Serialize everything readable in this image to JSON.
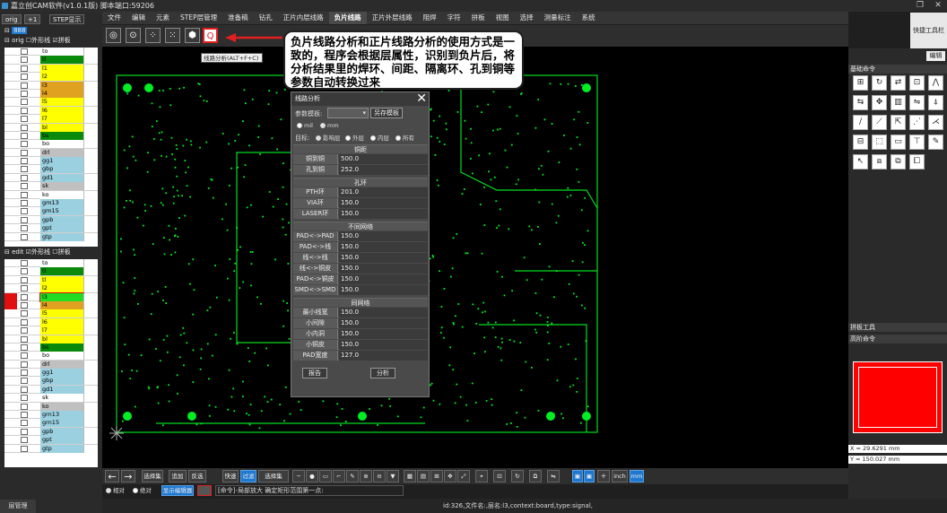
{
  "app": {
    "title": "嘉立创CAM软件(v1.0.1版) 脚本端口:59206"
  },
  "menu": [
    "文件",
    "编辑",
    "元素",
    "STEP层管理",
    "准备稿",
    "钻孔",
    "正片内层线路",
    "负片线路",
    "正片外层线路",
    "阻焊",
    "字符",
    "拼板",
    "视图",
    "选择",
    "测量标注",
    "系统"
  ],
  "menu_active_index": 7,
  "quick_toolbar_label": "快捷工具栏",
  "toolbar": {
    "buttons": [
      "◎",
      "⊙",
      "⁘",
      "⁙",
      "⬢",
      "Q"
    ],
    "tooltip": "线路分析(ALT+F+C)"
  },
  "callout": {
    "text": "负片线路分析和正片线路分析的使用方式是一致的，程序会根据层属性，识别到负片后，将分析结果里的焊环、间距、隔离环、孔到铜等参数自动转换过来"
  },
  "left_panel": {
    "tabs": [
      "orig",
      "+1",
      "STEP显示"
    ],
    "root": "888",
    "orig_group": {
      "label": "orig",
      "outline_label": "外形线",
      "panel_label": "拼板"
    },
    "edit_group": {
      "label": "edit",
      "outline_label": "外形线",
      "panel_label": "拼板"
    },
    "orig_layers": [
      {
        "name": "to",
        "color": "#ffffff"
      },
      {
        "name": "tl",
        "color": "#0a8a0a"
      },
      {
        "name": "l1",
        "color": "#ffff00"
      },
      {
        "name": "l2",
        "color": "#ffff00"
      },
      {
        "name": "l3",
        "color": "#e0a020"
      },
      {
        "name": "l4",
        "color": "#e0a020"
      },
      {
        "name": "l5",
        "color": "#ffff00"
      },
      {
        "name": "l6",
        "color": "#ffff00"
      },
      {
        "name": "l7",
        "color": "#ffff00"
      },
      {
        "name": "bl",
        "color": "#ffff00"
      },
      {
        "name": "bs",
        "color": "#0a8a0a"
      },
      {
        "name": "bo",
        "color": "#ffffff"
      },
      {
        "name": "drl",
        "color": "#c0c0c0"
      },
      {
        "name": "gg1",
        "color": "#9ad0e0"
      },
      {
        "name": "gbp",
        "color": "#9ad0e0"
      },
      {
        "name": "gd1",
        "color": "#9ad0e0"
      },
      {
        "name": "sk",
        "color": "#c0c0c0"
      },
      {
        "name": "ko",
        "color": "#ffffff"
      },
      {
        "name": "gm13",
        "color": "#9ad0e0"
      },
      {
        "name": "gm15",
        "color": "#9ad0e0"
      },
      {
        "name": "gpb",
        "color": "#9ad0e0"
      },
      {
        "name": "gpt",
        "color": "#9ad0e0"
      },
      {
        "name": "gtp",
        "color": "#9ad0e0"
      }
    ],
    "edit_layers": [
      {
        "name": "to",
        "color": "#ffffff"
      },
      {
        "name": "tl",
        "color": "#0a8a0a"
      },
      {
        "name": "tl",
        "color": "#ffff00"
      },
      {
        "name": "l2",
        "color": "#ffff00"
      },
      {
        "name": "l3",
        "color": "#e0a020"
      },
      {
        "name": "l4",
        "color": "#e0a020"
      },
      {
        "name": "l5",
        "color": "#ffff00"
      },
      {
        "name": "l6",
        "color": "#ffff00"
      },
      {
        "name": "l7",
        "color": "#ffff00"
      },
      {
        "name": "bl",
        "color": "#ffff00"
      },
      {
        "name": "bs",
        "color": "#0a8a0a"
      },
      {
        "name": "bo",
        "color": "#ffffff"
      },
      {
        "name": "drl",
        "color": "#c0c0c0"
      },
      {
        "name": "gg1",
        "color": "#9ad0e0"
      },
      {
        "name": "gbp",
        "color": "#9ad0e0"
      },
      {
        "name": "gd1",
        "color": "#9ad0e0"
      },
      {
        "name": "sk",
        "color": "#ffffff"
      },
      {
        "name": "ko",
        "color": "#c0c0c0"
      },
      {
        "name": "grn13",
        "color": "#9ad0e0"
      },
      {
        "name": "grn15",
        "color": "#9ad0e0"
      },
      {
        "name": "gpb",
        "color": "#9ad0e0"
      },
      {
        "name": "gpt",
        "color": "#9ad0e0"
      },
      {
        "name": "gtp",
        "color": "#9ad0e0"
      }
    ],
    "layer_manager_label": "层管理"
  },
  "dialog": {
    "title": "线路分析",
    "template_label": "参数模板:",
    "save_as_label": "另存模板",
    "unit_options": [
      "mil",
      "mm"
    ],
    "target_label": "目标:",
    "target_options": [
      "影响层",
      "外层",
      "内层",
      "所有"
    ],
    "sections": [
      {
        "title": "铜距",
        "rows": [
          {
            "label": "铜到铜",
            "value": "500.0"
          },
          {
            "label": "孔到铜",
            "value": "252.0"
          }
        ]
      },
      {
        "title": "孔环",
        "rows": [
          {
            "label": "PTH环",
            "value": "201.0"
          },
          {
            "label": "VIA环",
            "value": "150.0"
          },
          {
            "label": "LASER环",
            "value": "150.0"
          }
        ]
      },
      {
        "title": "不同网络",
        "rows": [
          {
            "label": "PAD<->PAD",
            "value": "150.0"
          },
          {
            "label": "PAD<->线",
            "value": "150.0"
          },
          {
            "label": "线<->线",
            "value": "150.0"
          },
          {
            "label": "线<->铜皮",
            "value": "150.0"
          },
          {
            "label": "PAD<->铜皮",
            "value": "150.0"
          },
          {
            "label": "SMD<->SMD",
            "value": "150.0"
          }
        ]
      },
      {
        "title": "同网络",
        "rows": [
          {
            "label": "最小线宽",
            "value": "150.0"
          },
          {
            "label": "小间隙",
            "value": "150.0"
          },
          {
            "label": "小内洞",
            "value": "150.0"
          },
          {
            "label": "小铜皮",
            "value": "150.0"
          },
          {
            "label": "PAD宽度",
            "value": "127.0"
          }
        ]
      }
    ],
    "report_label": "报告",
    "analyze_label": "分析"
  },
  "right_panel": {
    "edit_label": "编辑",
    "basic_cmd_label": "基础命令",
    "panel_tools_label": "拼板工具",
    "advanced_cmd_label": "高阶命令",
    "coord_x": "X = 29.6291 mm",
    "coord_y": "Y = 150.027 mm",
    "cmd_icons": [
      "⊞",
      "↻",
      "⇄",
      "⊡",
      "⋀",
      "⇆",
      "✥",
      "▥",
      "⇋",
      "⍋",
      "∕",
      "⟋",
      "⇱",
      "⋰",
      "⋌",
      "⊟",
      "⬚",
      "▭",
      "⊤",
      "✎",
      "↖",
      "⧈",
      "⧉",
      "⧠"
    ]
  },
  "bottom": {
    "buttons": [
      "选择集",
      "追加",
      "反选",
      "快速",
      "过滤",
      "选择集dcode"
    ],
    "unit_inch": "inch",
    "unit_mm": "mm",
    "mode_relative": "相对",
    "mode_absolute": "绝对",
    "show_editor": "显示编辑器",
    "command_text": "[命令]-局部放大 确定矩形范围第一点:",
    "status_text": "id:326,文件名:,层名:l3,context:board,type:signal,"
  }
}
